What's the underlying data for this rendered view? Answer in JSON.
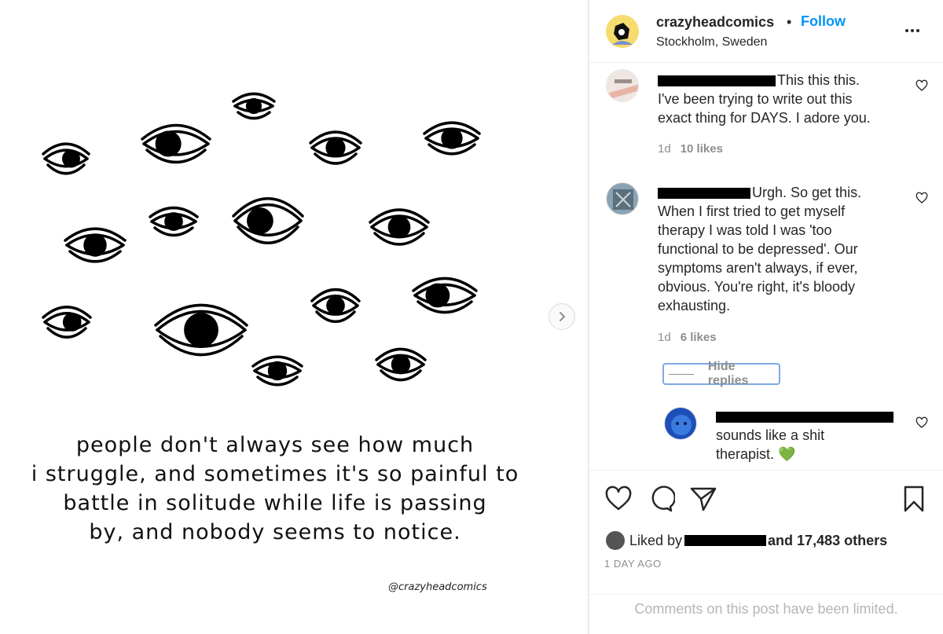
{
  "post": {
    "caption_lines": [
      "people don't always see how much",
      "i struggle, and sometimes it's so painful to",
      "battle in solitude while life is passing",
      "by, and nobody seems to notice."
    ],
    "signature": "@crazyheadcomics"
  },
  "header": {
    "username": "crazyheadcomics",
    "separator": "•",
    "follow_label": "Follow",
    "location": "Stockholm, Sweden"
  },
  "comments": [
    {
      "text_lines": [
        "This this this.",
        "I've been trying to write out this",
        "exact thing for DAYS. I adore you."
      ],
      "time": "1d",
      "likes": "10 likes"
    },
    {
      "text_lines": [
        "Urgh. So get this.",
        "When I first tried to get myself",
        "therapy I was told I was 'too",
        "functional to be depressed'. Our",
        "symptoms aren't always, if ever,",
        "obvious. You're right, it's bloody",
        "exhausting."
      ],
      "time": "1d",
      "likes": "6 likes"
    }
  ],
  "hide_replies_label": "Hide replies",
  "reply": {
    "text_lines": [
      "sounds like a shit",
      "therapist. 💚"
    ]
  },
  "likes": {
    "prefix": "Liked by",
    "suffix": "and 17,483 others"
  },
  "time_ago": "1 DAY AGO",
  "comments_limited": "Comments on this post have been limited.",
  "colors": {
    "accent": "#0095f6",
    "muted": "#8e8e8e",
    "text": "#262626",
    "border": "#dbdbdb"
  }
}
